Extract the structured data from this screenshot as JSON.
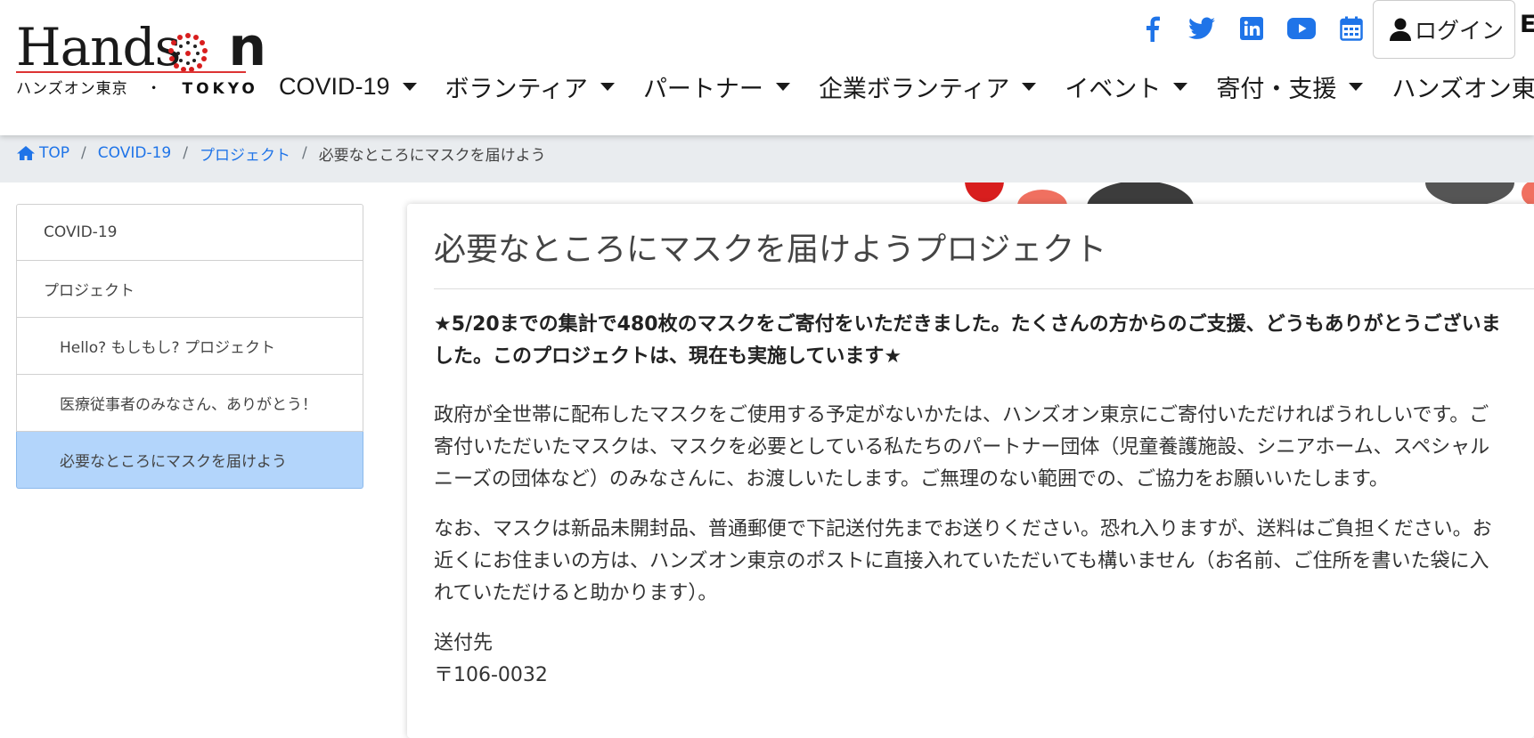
{
  "logo": {
    "main_left": "Hands",
    "main_right": "n",
    "sub_left": "ハンズオン東京",
    "sub_dot": "・",
    "sub_right": "TOKYO"
  },
  "social": {
    "icons": [
      "facebook-icon",
      "twitter-icon",
      "linkedin-icon",
      "youtube-icon",
      "calendar-icon"
    ],
    "brand_color": "#1f74e8"
  },
  "header": {
    "login_label": "ログイン",
    "lang_label": "E"
  },
  "nav": {
    "items": [
      "COVID-19",
      "ボランティア",
      "パートナー",
      "企業ボランティア",
      "イベント",
      "寄付・支援",
      "ハンズオン東京に"
    ]
  },
  "breadcrumb": {
    "home": "TOP",
    "items": [
      "COVID-19",
      "プロジェクト"
    ],
    "current": "必要なところにマスクを届けよう"
  },
  "sidebar": {
    "items": [
      "COVID-19",
      "プロジェクト",
      "Hello? もしもし? プロジェクト",
      "医療従事者のみなさん、ありがとう！",
      "必要なところにマスクを届けよう"
    ],
    "active_color": "#b3d5fb"
  },
  "main": {
    "title": "必要なところにマスクを届けようプロジェクト",
    "lead": "★5/20までの集計で480枚のマスクをご寄付をいただきました。たくさんの方からのご支援、どうもありがとうございました。このプロジェクトは、現在も実施しています★",
    "para1": "政府が全世帯に配布したマスクをご使用する予定がないかたは、ハンズオン東京にご寄付いただければうれしいです。ご寄付いただいたマスクは、マスクを必要としている私たちのパートナー団体（児童養護施設、シニアホーム、スペシャルニーズの団体など）のみなさんに、お渡しいたします。ご無理のない範囲での、ご協力をお願いいたします。",
    "para2": "なお、マスクは新品未開封品、普通郵便で下記送付先までお送りください。恐れ入りますが、送料はご負担ください。お近くにお住まいの方は、ハンズオン東京のポストに直接入れていただいても構いません（お名前、ご住所を書いた袋に入れていただけると助かります）。",
    "addr_label": "送付先",
    "addr_postal": "〒106-0032"
  }
}
